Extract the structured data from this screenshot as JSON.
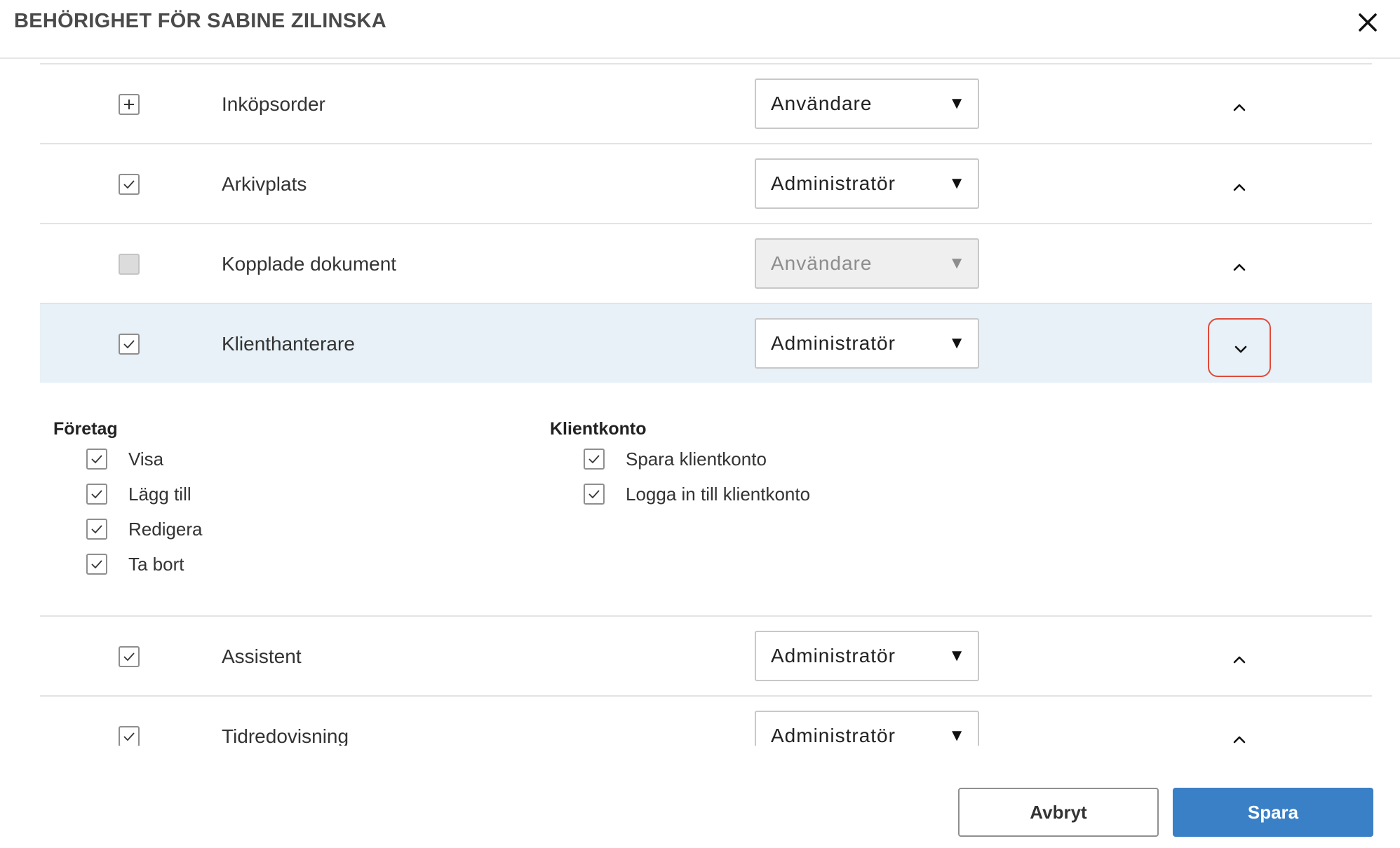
{
  "dialog": {
    "title": "BEHÖRIGHET FÖR SABINE ZILINSKA"
  },
  "icons": {
    "close": "close-icon",
    "collapse": "chevron-up-icon",
    "expand": "chevron-down-icon",
    "check": "check-icon",
    "plus": "plus-icon"
  },
  "rows": [
    {
      "label": "Inköpsorder",
      "state": "partial",
      "role": "Användare",
      "disabled": false,
      "expanded": false
    },
    {
      "label": "Arkivplats",
      "state": "checked",
      "role": "Administratör",
      "disabled": false,
      "expanded": false
    },
    {
      "label": "Kopplade dokument",
      "state": "disabled",
      "role": "Användare",
      "disabled": true,
      "expanded": false
    },
    {
      "label": "Klienthanterare",
      "state": "checked",
      "role": "Administratör",
      "disabled": false,
      "expanded": true
    },
    {
      "label": "Assistent",
      "state": "checked",
      "role": "Administratör",
      "disabled": false,
      "expanded": false
    },
    {
      "label": "Tidredovisning",
      "state": "checked",
      "role": "Administratör",
      "disabled": false,
      "expanded": false
    }
  ],
  "select_arrow": "▼",
  "details": {
    "groups": [
      {
        "title": "Företag",
        "items": [
          "Visa",
          "Lägg till",
          "Redigera",
          "Ta bort"
        ]
      },
      {
        "title": "Klientkonto",
        "items": [
          "Spara klientkonto",
          "Logga in till klientkonto"
        ]
      }
    ]
  },
  "footer": {
    "cancel_label": "Avbryt",
    "save_label": "Spara"
  },
  "colors": {
    "primary": "#3a80c6",
    "highlight_row": "#e7f1f7",
    "focus_ring": "#e04a3a"
  }
}
